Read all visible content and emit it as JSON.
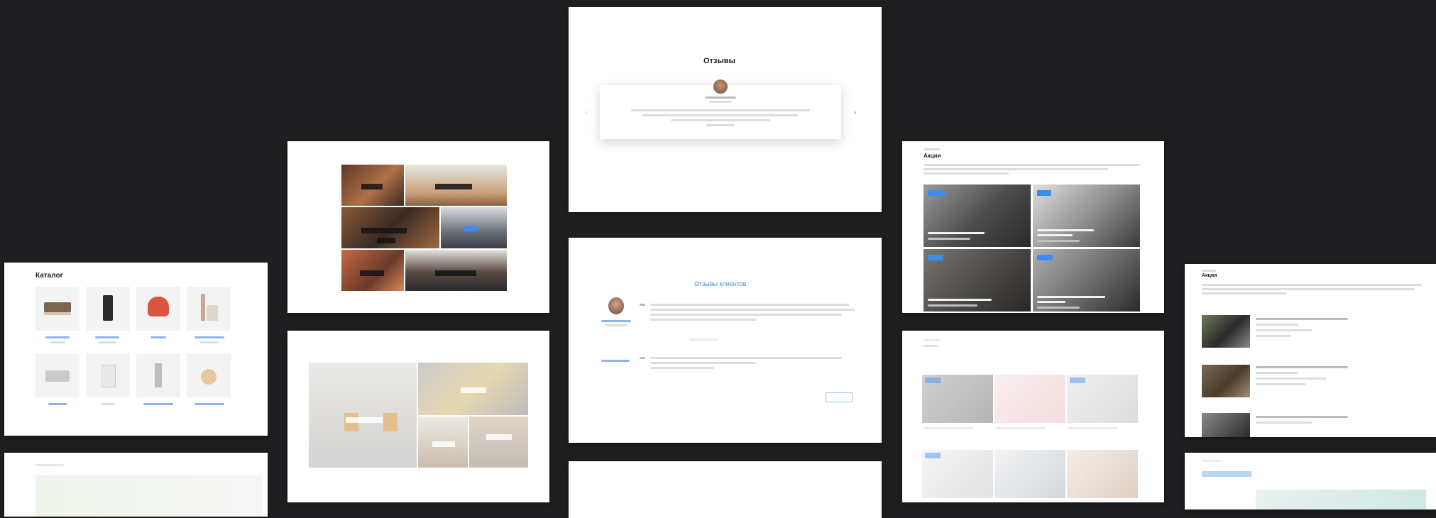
{
  "screens": {
    "testimonials_top": {
      "title": "Отзывы"
    },
    "reviews_middle": {
      "title": "Отзывы клиентов"
    },
    "catalog": {
      "title": "Каталог"
    },
    "news_grid": {
      "title": "Акции"
    },
    "news_list": {
      "title": "Акции"
    }
  },
  "colors": {
    "background": "#1f1f21",
    "accent": "#3b8cf0",
    "card": "#ffffff"
  },
  "icons": {
    "carousel_prev": "chevron-left-icon",
    "carousel_next": "chevron-right-icon"
  }
}
